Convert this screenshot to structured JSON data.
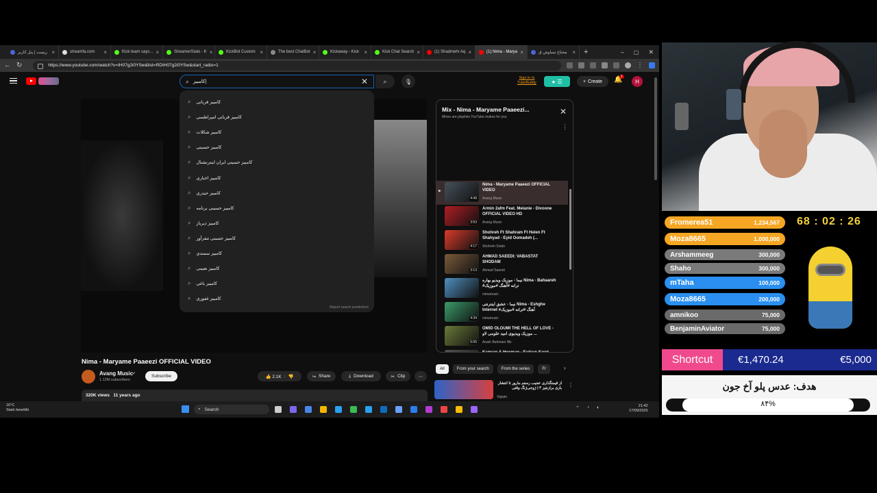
{
  "browser": {
    "tabs": [
      {
        "label": "ریست | پنل کاربر",
        "fav": "#4a64d8"
      },
      {
        "label": "streamfa.com",
        "fav": "#dddddd"
      },
      {
        "label": "Kick team says...",
        "fav": "#53fc18"
      },
      {
        "label": "StreamerStats - K",
        "fav": "#53fc18"
      },
      {
        "label": "KickBot Custom",
        "fav": "#53fc18"
      },
      {
        "label": "The best ChatBot",
        "fav": "#888888"
      },
      {
        "label": "Kickaway - Kick",
        "fav": "#53fc18"
      },
      {
        "label": "Kick Chat Search",
        "fav": "#53fc18"
      },
      {
        "label": "(1) Shadmehr Aq",
        "fav": "#ff0000"
      },
      {
        "label": "(1) Nima - Marya",
        "fav": "#ff0000",
        "active": true
      },
      {
        "label": "محتاج سیاوش ق",
        "fav": "#4a64d8"
      }
    ],
    "new_tab": "+",
    "url": "https://www.youtube.com/watch?v=IH07g2i0YSw&list=RDIH07g2i0YSw&start_radio=1"
  },
  "youtube": {
    "search_value": "کامبیز|",
    "mic_icon": "microphone-icon",
    "signin_line1": "Sign in to",
    "signin_line2": "TubeBuddy",
    "create_label": "Create",
    "notif_count": "1",
    "avatar_letter": "H",
    "suggestions": [
      "کامبیز قربانی",
      "کامبیز قربانی امپراطسی",
      "کامبیز شکلات",
      "کامبیز حسینی",
      "کامبیز حسینی ایران اینترنشنال",
      "کامبیز اخباری",
      "کامبیز حیدری",
      "کامبیز حسینی برنامه",
      "کامبیز دیرباز",
      "کامبیز حسینی تنفرآور",
      "کامبیز سمندی",
      "کامبیز نعیمی",
      "کامبیز باغی",
      "کامبیز غفوری"
    ],
    "report_label": "Report search predictions",
    "video_title": "Nima - Maryame Paaeezi OFFICIAL VIDEO",
    "channel": "Avang Music",
    "subscribers": "1.12M subscribers",
    "subscribe_label": "Subscribe",
    "likes": "2.1K",
    "share_label": "Share",
    "download_label": "Download",
    "clip_label": "Clip",
    "views": "320K views",
    "age": "11 years ago",
    "mix": {
      "title": "Mix - Nima - Maryame Paaeezi...",
      "subtitle": "Mixes are playlists YouTube makes for you",
      "items": [
        {
          "title": "Nima - Maryame Paaeezi OFFICIAL VIDEO",
          "channel": "Avang Music",
          "dur": "4:49",
          "color": "#46505a",
          "current": true
        },
        {
          "title": "Armin 2afm Feat. Melanie - Divoone OFFICIAL VIDEO HD",
          "channel": "Avang Music",
          "dur": "3:53",
          "color": "#b01d24"
        },
        {
          "title": "Shohreh Ft Shahram Ft Helen Ft Shahyad - Eyid Oomadeh (...",
          "channel": "Shohreh Solati",
          "dur": "4:17",
          "color": "#d93a2a"
        },
        {
          "title": "AHMAD SAEEDI: VABASTAT SHODAM",
          "channel": "Ahmad Saeedi",
          "dur": "3:13",
          "color": "#7a5a3a"
        },
        {
          "title": "نیما - موزیک ویدیو بهاره Nima - Bahaareh #ترانه #آهنگ #موزیک",
          "channel": "nimamusic",
          "dur": "",
          "color": "#4f8fc0"
        },
        {
          "title": "نیما - عشق اینترنتی Nima - Eshghe Internet #آهنگ #ترانه #موزیک",
          "channel": "nimamusic",
          "dur": "4:34",
          "color": "#3a9a6a"
        },
        {
          "title": "OMID OLOUMI THE HELL OF LOVE - موزیک ویدیوی امید علومی لاو ...",
          "channel": "Arash Bahmani Nik",
          "dur": "5:05",
          "color": "#6a7a3a"
        },
        {
          "title": "Kamran & Hooman - Fadaye Saret OFFICIAL VIDEO",
          "channel": "Avang Music",
          "dur": "4:38",
          "color": "#555555"
        },
        {
          "title": "Kamran Hooman - Man Age Nabasham OFFICIAL VIDEO",
          "channel": "Avang Music",
          "dur": "4:53",
          "color": "#3b4b5b"
        }
      ]
    },
    "chips": [
      "All",
      "From your search",
      "From the series",
      "Fr"
    ],
    "rec_title": "از قیمتگذاری عجیب رستم مارور تا انتشار بازی برازنتیز ۳ | ژوجی‌ژنگ وقتی",
    "rec_channel": "Vigiato"
  },
  "taskbar": {
    "weather_temp": "16°C",
    "weather_desc": "Stark bewölkt",
    "search_placeholder": "Search",
    "time": "21:42",
    "date": "17/09/2025"
  },
  "overlay": {
    "timer": "68 : 02 : 26",
    "leaderboard": [
      {
        "name": "Fromerea51",
        "amount": "1,234,567",
        "color": "#f5a623"
      },
      {
        "name": "Moza8665",
        "amount": "1,000,000",
        "color": "#f5a623"
      },
      {
        "name": "Arshammeeg",
        "amount": "300,000",
        "color": "#7a7a7a"
      },
      {
        "name": "Shaho",
        "amount": "300,000",
        "color": "#7a7a7a"
      },
      {
        "name": "mTaha",
        "amount": "100,000",
        "color": "#2a8ff0"
      },
      {
        "name": "Moza8665",
        "amount": "200,000",
        "color": "#2a8ff0"
      },
      {
        "name": "amnikoo",
        "amount": "75,000",
        "color": "#6a6a6a"
      },
      {
        "name": "BenjaminAviator",
        "amount": "75,000",
        "color": "#6a6a6a"
      }
    ],
    "shortcut_label": "Shortcut",
    "raised": "€1,470.24",
    "goal": "€5,000",
    "goal_title": "هدف: عدس پلو آخ جون",
    "goal_percent": "۸۴%",
    "goal_fraction": 0.84
  }
}
